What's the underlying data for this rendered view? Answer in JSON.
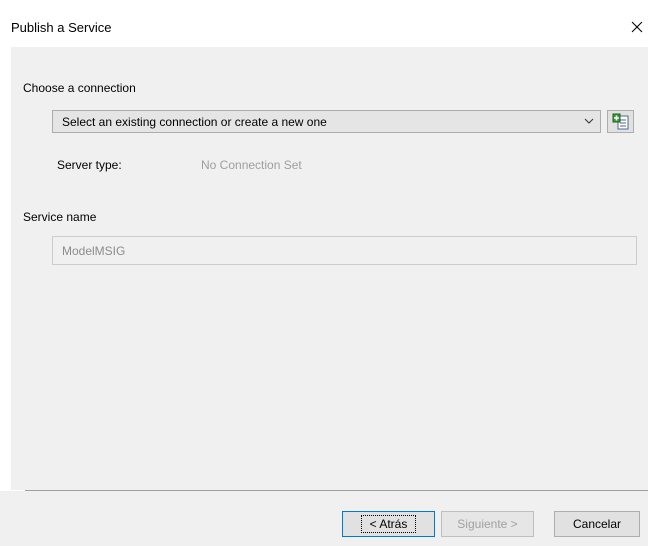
{
  "dialog": {
    "title": "Publish a Service"
  },
  "connection": {
    "section_label": "Choose a connection",
    "selected_value": "Select an existing connection or create a new one",
    "server_type_label": "Server type:",
    "server_type_value": "No Connection Set"
  },
  "service": {
    "section_label": "Service name",
    "name_value": "ModelMSIG"
  },
  "buttons": {
    "back_label": "< Atrás",
    "next_label": "Siguiente >",
    "cancel_label": "Cancelar"
  },
  "icons": {
    "close": "close-icon",
    "dropdown": "chevron-down-icon",
    "new_connection": "new-connection-icon"
  },
  "colors": {
    "dialog_background": "#f0f0f0",
    "focus_border": "#0078d7",
    "disabled_text": "#a0a0a0"
  }
}
